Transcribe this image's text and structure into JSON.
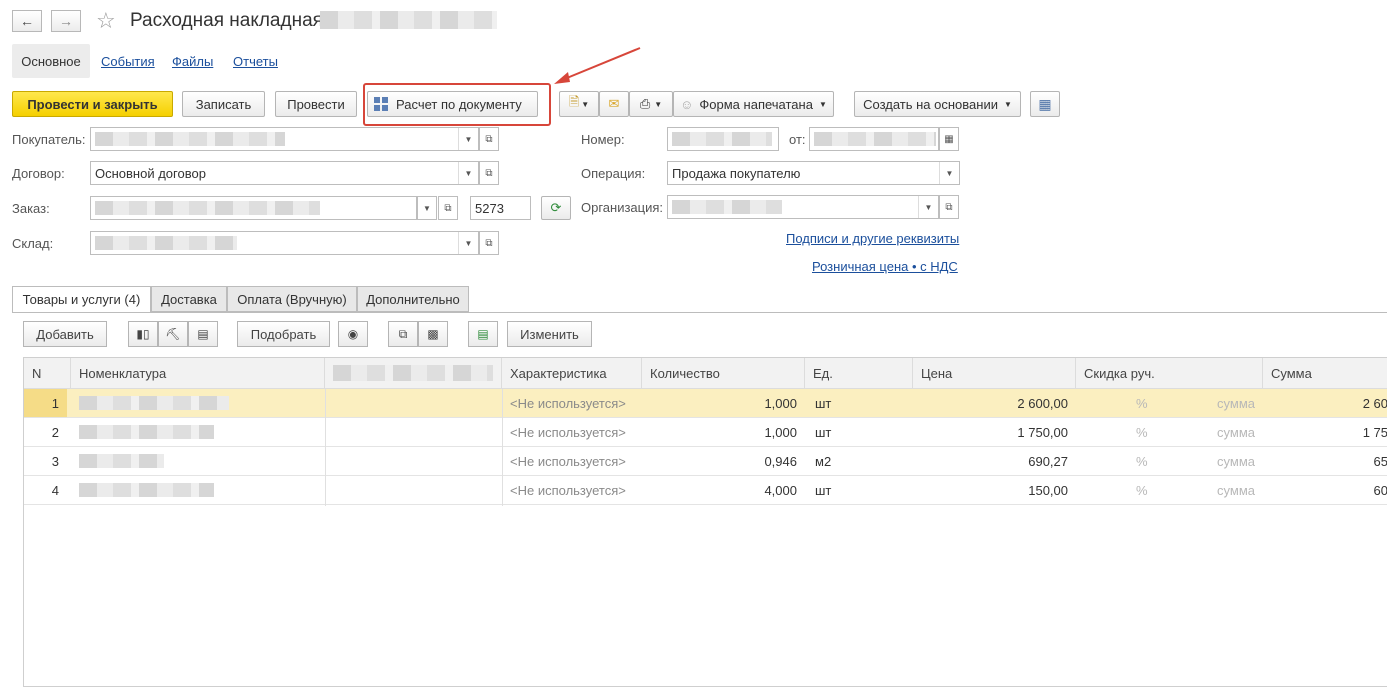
{
  "window": {
    "title": "Расходная накладная"
  },
  "nav": {
    "back": "🡐",
    "forward": "🡒"
  },
  "form_tabs": [
    {
      "label": "Основное"
    },
    {
      "label": "События"
    },
    {
      "label": "Файлы"
    },
    {
      "label": "Отчеты"
    }
  ],
  "toolbar": {
    "post_close": "Провести и закрыть",
    "save": "Записать",
    "post": "Провести",
    "calc": "Расчет по документу",
    "print_form": "Форма напечатана",
    "create_based": "Создать на основании"
  },
  "form": {
    "buyer_label": "Покупатель:",
    "contract_label": "Договор:",
    "contract_value": "Основной договор",
    "order_label": "Заказ:",
    "order_number": "5273",
    "warehouse_label": "Склад:",
    "number_label": "Номер:",
    "date_label": "от:",
    "operation_label": "Операция:",
    "operation_value": "Продажа покупателю",
    "org_label": "Организация:",
    "signatures_link": "Подписи и другие реквизиты",
    "price_link": "Розничная цена • с НДС"
  },
  "content_tabs": [
    {
      "label": "Товары и услуги (4)"
    },
    {
      "label": "Доставка"
    },
    {
      "label": "Оплата (Вручную)"
    },
    {
      "label": "Дополнительно"
    }
  ],
  "table_toolbar": {
    "add": "Добавить",
    "select": "Подобрать",
    "change": "Изменить"
  },
  "table": {
    "headers": {
      "n": "N",
      "nomenclature": "Номенклатура",
      "characteristic": "Характеристика",
      "quantity": "Количество",
      "unit": "Ед.",
      "price": "Цена",
      "discount": "Скидка руч.",
      "sum": "Сумма"
    },
    "rows": [
      {
        "n": "1",
        "characteristic": "<Не используется>",
        "quantity": "1,000",
        "unit": "шт",
        "price": "2 600,00",
        "pct": "%",
        "sum_hint": "сумма",
        "sum": "2 60"
      },
      {
        "n": "2",
        "characteristic": "<Не используется>",
        "quantity": "1,000",
        "unit": "шт",
        "price": "1 750,00",
        "pct": "%",
        "sum_hint": "сумма",
        "sum": "1 75"
      },
      {
        "n": "3",
        "characteristic": "<Не используется>",
        "quantity": "0,946",
        "unit": "м2",
        "price": "690,27",
        "pct": "%",
        "sum_hint": "сумма",
        "sum": "65"
      },
      {
        "n": "4",
        "characteristic": "<Не используется>",
        "quantity": "4,000",
        "unit": "шт",
        "price": "150,00",
        "pct": "%",
        "sum_hint": "сумма",
        "sum": "60"
      }
    ]
  },
  "colors": {
    "accent_yellow": "#f5d000",
    "link_blue": "#1b4f9c",
    "highlight_red": "#d7463a",
    "selected_row": "#fbefc0"
  }
}
